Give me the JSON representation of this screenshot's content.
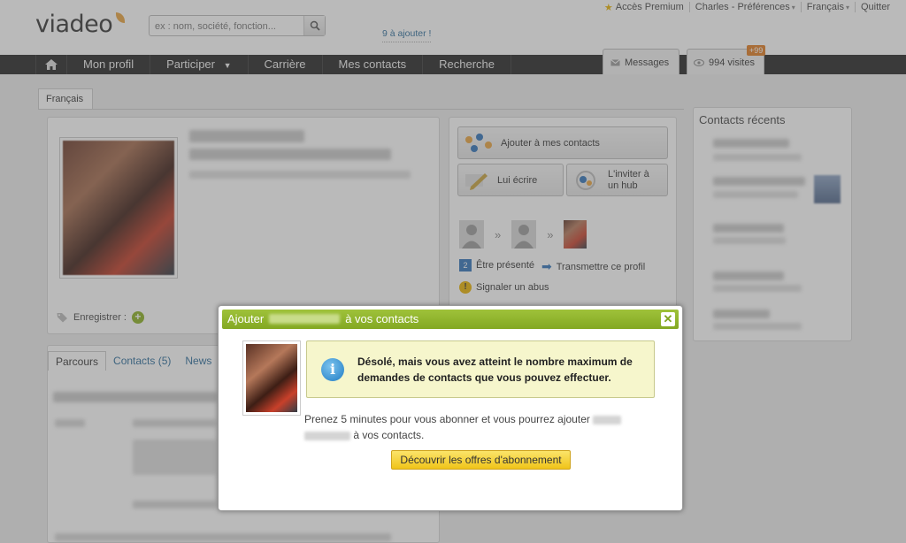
{
  "header": {
    "logo": "viadeo",
    "search_placeholder": "ex : nom, société, fonction...",
    "top_links": {
      "premium": "Accès Premium",
      "user": "Charles - Préférences",
      "language": "Français",
      "logout": "Quitter"
    },
    "to_add": "9 à ajouter !"
  },
  "nav": {
    "items": [
      "Mon profil",
      "Participer",
      "Carrière",
      "Mes contacts",
      "Recherche"
    ],
    "messages": "Messages",
    "visits": "994 visites",
    "visits_badge": "+99"
  },
  "page": {
    "lang_tab": "Français",
    "register_label": "Enregistrer :",
    "actions": {
      "add_contact": "Ajouter à mes contacts",
      "write": "Lui écrire",
      "invite": "L'inviter à un hub",
      "introduce": "Être présenté",
      "forward": "Transmettre ce profil",
      "report": "Signaler un abus"
    },
    "tabs": [
      "Parcours",
      "Contacts (5)",
      "News"
    ],
    "recent_contacts_title": "Contacts récents"
  },
  "modal": {
    "title_prefix": "Ajouter",
    "title_suffix": "à vos contacts",
    "alert": "Désolé, mais vous avez atteint le nombre maximum de demandes de contacts que vous pouvez effectuer.",
    "message_part1": "Prenez 5 minutes pour vous abonner et vous pourrez ajouter",
    "message_part2": "à vos contacts.",
    "cta": "Découvrir les offres d'abonnement",
    "close": "✕"
  },
  "colors": {
    "nav_bg": "#242424",
    "modal_header": "#8fb52c",
    "alert_bg": "#f6f6cc",
    "cta_bg": "#f4d031",
    "badge": "#e07a20"
  }
}
